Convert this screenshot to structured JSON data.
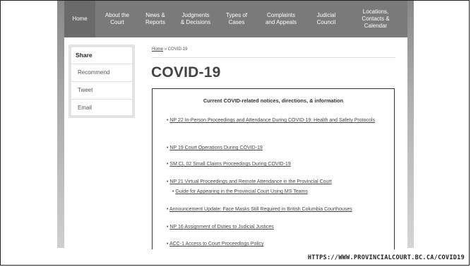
{
  "nav": {
    "items": [
      {
        "label": "Home"
      },
      {
        "label": "About the\nCourt"
      },
      {
        "label": "News &\nReports"
      },
      {
        "label": "Judgments\n& Decisions"
      },
      {
        "label": "Types of\nCases"
      },
      {
        "label": "Complaints\nand Appeals"
      },
      {
        "label": "Judicial\nCouncil"
      },
      {
        "label": "Locations,\nContacts &\nCalendar"
      }
    ]
  },
  "sidebar": {
    "title": "Share",
    "items": [
      {
        "label": "Recommend"
      },
      {
        "label": "Tweet"
      },
      {
        "label": "Email"
      }
    ]
  },
  "breadcrumb": {
    "home": "Home",
    "separator": "»",
    "current": "COVID-19"
  },
  "page": {
    "title": "COVID-19"
  },
  "notices": {
    "heading": "Current COVID-related notices, directions, & information",
    "bullet": "•",
    "items": [
      {
        "text": "NP 22 In-Person Proceedings and Attendance During COVID-19: Health and Safety Protocols"
      },
      {
        "text": "NP 19 Court Operations During COVID-19"
      },
      {
        "text": "SM CL 02 Small Claims Proceedings During COVID-19"
      },
      {
        "text": "NP 21 Virtual Proceedings and Remote Attendance in the Provincial Court"
      },
      {
        "text": "Guide for Appearing in the Provincial Court Using MS Teams"
      },
      {
        "text": "Announcement Update: Face Masks Still Required in British Columbia Courthouses"
      },
      {
        "text": "NP 16 Assignment of Duties to Judicial Justices"
      },
      {
        "text": "ACC-1 Access to Court Proceedings Policy"
      }
    ]
  },
  "caption": {
    "url": "HTTPS://WWW.PROVINCIALCOURT.BC.CA/COVID19"
  }
}
